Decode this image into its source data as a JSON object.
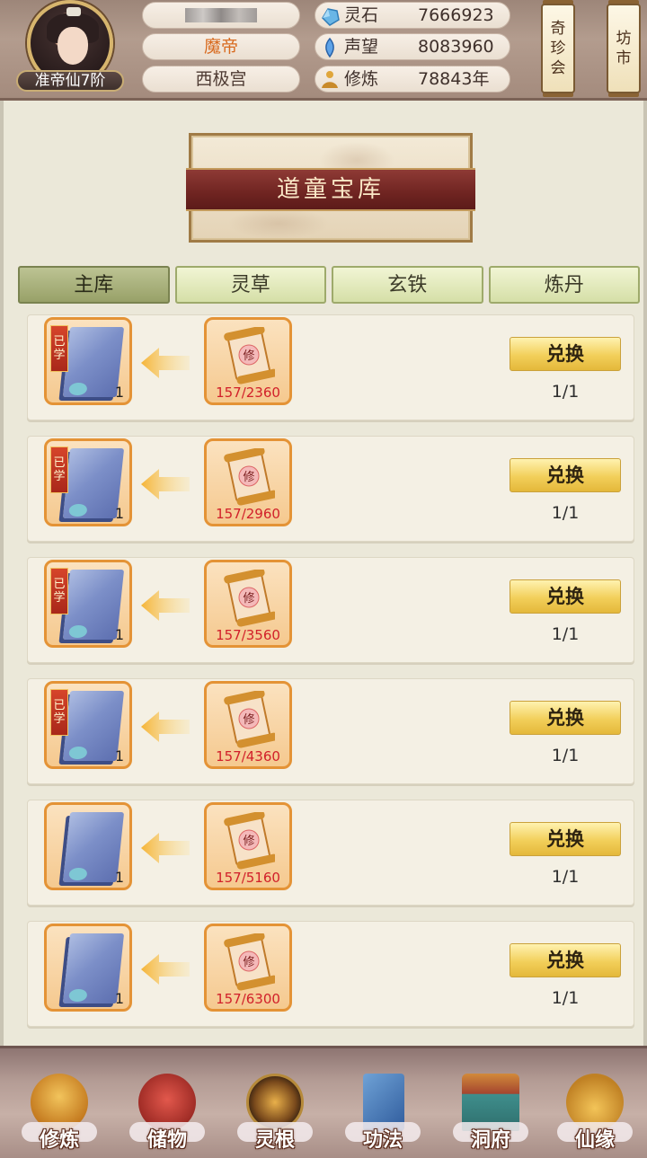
{
  "header": {
    "rank": "准帝仙7阶",
    "title": "魔帝",
    "sect": "西极宫",
    "stats": [
      {
        "label": "灵石",
        "value": "7666923",
        "icon": "spirit-stone-icon"
      },
      {
        "label": "声望",
        "value": "8083960",
        "icon": "prestige-crystal-icon"
      },
      {
        "label": "修炼",
        "value": "78843年",
        "icon": "meditation-icon"
      }
    ],
    "side_buttons": [
      {
        "label_chars": [
          "奇",
          "珍",
          "会"
        ]
      },
      {
        "label_chars": [
          "坊",
          "市"
        ]
      }
    ]
  },
  "banner": {
    "title": "道童宝库"
  },
  "tabs": [
    "主库",
    "灵草",
    "玄铁",
    "炼丹"
  ],
  "active_tab": 0,
  "items": [
    {
      "learned": true,
      "learned_chars": [
        "已",
        "学"
      ],
      "qty": "1",
      "progress": "157/2360",
      "button": "兑换",
      "limit": "1/1"
    },
    {
      "learned": true,
      "learned_chars": [
        "已",
        "学"
      ],
      "qty": "1",
      "progress": "157/2960",
      "button": "兑换",
      "limit": "1/1"
    },
    {
      "learned": true,
      "learned_chars": [
        "已",
        "学"
      ],
      "qty": "1",
      "progress": "157/3560",
      "button": "兑换",
      "limit": "1/1"
    },
    {
      "learned": true,
      "learned_chars": [
        "已",
        "学"
      ],
      "qty": "1",
      "progress": "157/4360",
      "button": "兑换",
      "limit": "1/1"
    },
    {
      "learned": false,
      "qty": "1",
      "progress": "157/5160",
      "button": "兑换",
      "limit": "1/1"
    },
    {
      "learned": false,
      "qty": "1",
      "progress": "157/6300",
      "button": "兑换",
      "limit": "1/1"
    }
  ],
  "scroll_glyph": "修",
  "bottom_nav": [
    {
      "label": "修炼",
      "icon": "cultivator-icon"
    },
    {
      "label": "储物",
      "icon": "storage-bag-icon"
    },
    {
      "label": "灵根",
      "icon": "spirit-root-icon"
    },
    {
      "label": "功法",
      "icon": "technique-book-icon"
    },
    {
      "label": "洞府",
      "icon": "cave-palace-icon"
    },
    {
      "label": "仙缘",
      "icon": "gourd-icon"
    }
  ],
  "colors": {
    "accent_orange": "#e49336",
    "progress_red": "#d1202a",
    "banner_red": "#7a2a26"
  }
}
